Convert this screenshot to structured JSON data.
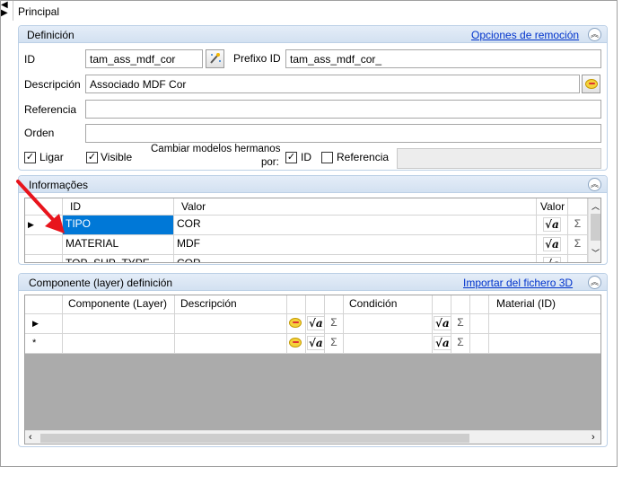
{
  "window": {
    "title": "Principal"
  },
  "definicion": {
    "title": "Definición",
    "link": "Opciones de remoción",
    "id_label": "ID",
    "id_value": "tam_ass_mdf_cor",
    "prefijo_label": "Prefixo ID",
    "prefijo_value": "tam_ass_mdf_cor_",
    "descripcion_label": "Descripción",
    "descripcion_value": "Associado MDF Cor",
    "referencia_label": "Referencia",
    "referencia_value": "",
    "orden_label": "Orden",
    "orden_value": "",
    "ligar_label": "Ligar",
    "visible_label": "Visible",
    "cambiar_label_1": "Cambiar modelos hermanos",
    "cambiar_label_2": "por:",
    "id_check_label": "ID",
    "referencia_check_label": "Referencia",
    "checks": {
      "ligar": true,
      "visible": true,
      "id": true,
      "referencia": false
    }
  },
  "informacoes": {
    "title": "Informações",
    "columns": [
      "ID",
      "Valor",
      "Valor"
    ],
    "rows": [
      {
        "id": "TIPO",
        "valor": "COR"
      },
      {
        "id": "MATERIAL",
        "valor": "MDF"
      },
      {
        "id": "TOP_SUP_TYPE",
        "valor": "COR"
      }
    ]
  },
  "componente": {
    "title": "Componente (layer) definición",
    "link": "Importar del fichero 3D",
    "columns": [
      "Componente (Layer)",
      "Descripción",
      "Condición",
      "Material (ID)"
    ],
    "row_markers": [
      "▶",
      "*"
    ]
  },
  "icons": {
    "sqrt": "√a",
    "sigma": "Σ",
    "collapse": "⌃"
  },
  "colors": {
    "selection": "#0078d7",
    "header_bg": "#d3e1f1",
    "link": "#0033cc",
    "arrow": "#e8141c"
  }
}
